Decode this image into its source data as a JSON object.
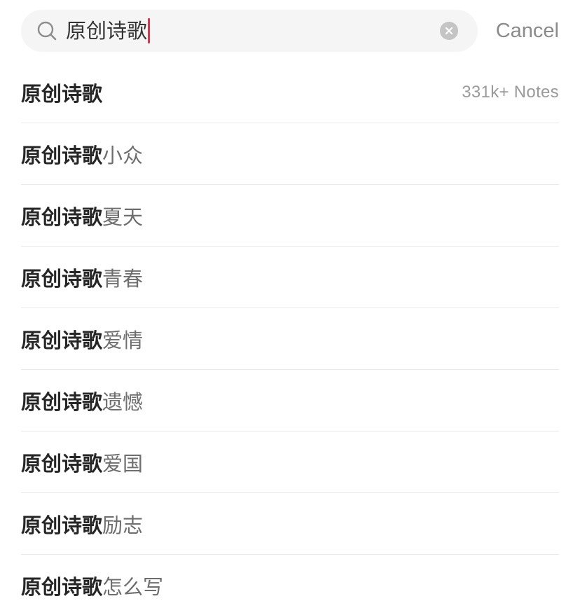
{
  "search": {
    "query": "原创诗歌",
    "icon": "search-icon",
    "clear_icon": "clear-icon",
    "cancel_label": "Cancel"
  },
  "suggestions": [
    {
      "match": "原创诗歌",
      "rest": "",
      "count": "331k+ Notes"
    },
    {
      "match": "原创诗歌",
      "rest": "小众",
      "count": ""
    },
    {
      "match": "原创诗歌",
      "rest": "夏天",
      "count": ""
    },
    {
      "match": "原创诗歌",
      "rest": "青春",
      "count": ""
    },
    {
      "match": "原创诗歌",
      "rest": "爱情",
      "count": ""
    },
    {
      "match": "原创诗歌",
      "rest": "遗憾",
      "count": ""
    },
    {
      "match": "原创诗歌",
      "rest": "爱国",
      "count": ""
    },
    {
      "match": "原创诗歌",
      "rest": "励志",
      "count": ""
    },
    {
      "match": "原创诗歌",
      "rest": "怎么写",
      "count": ""
    }
  ],
  "colors": {
    "caret": "#ff2442",
    "search_bg": "#f5f5f5",
    "divider": "#e9e9e9"
  }
}
